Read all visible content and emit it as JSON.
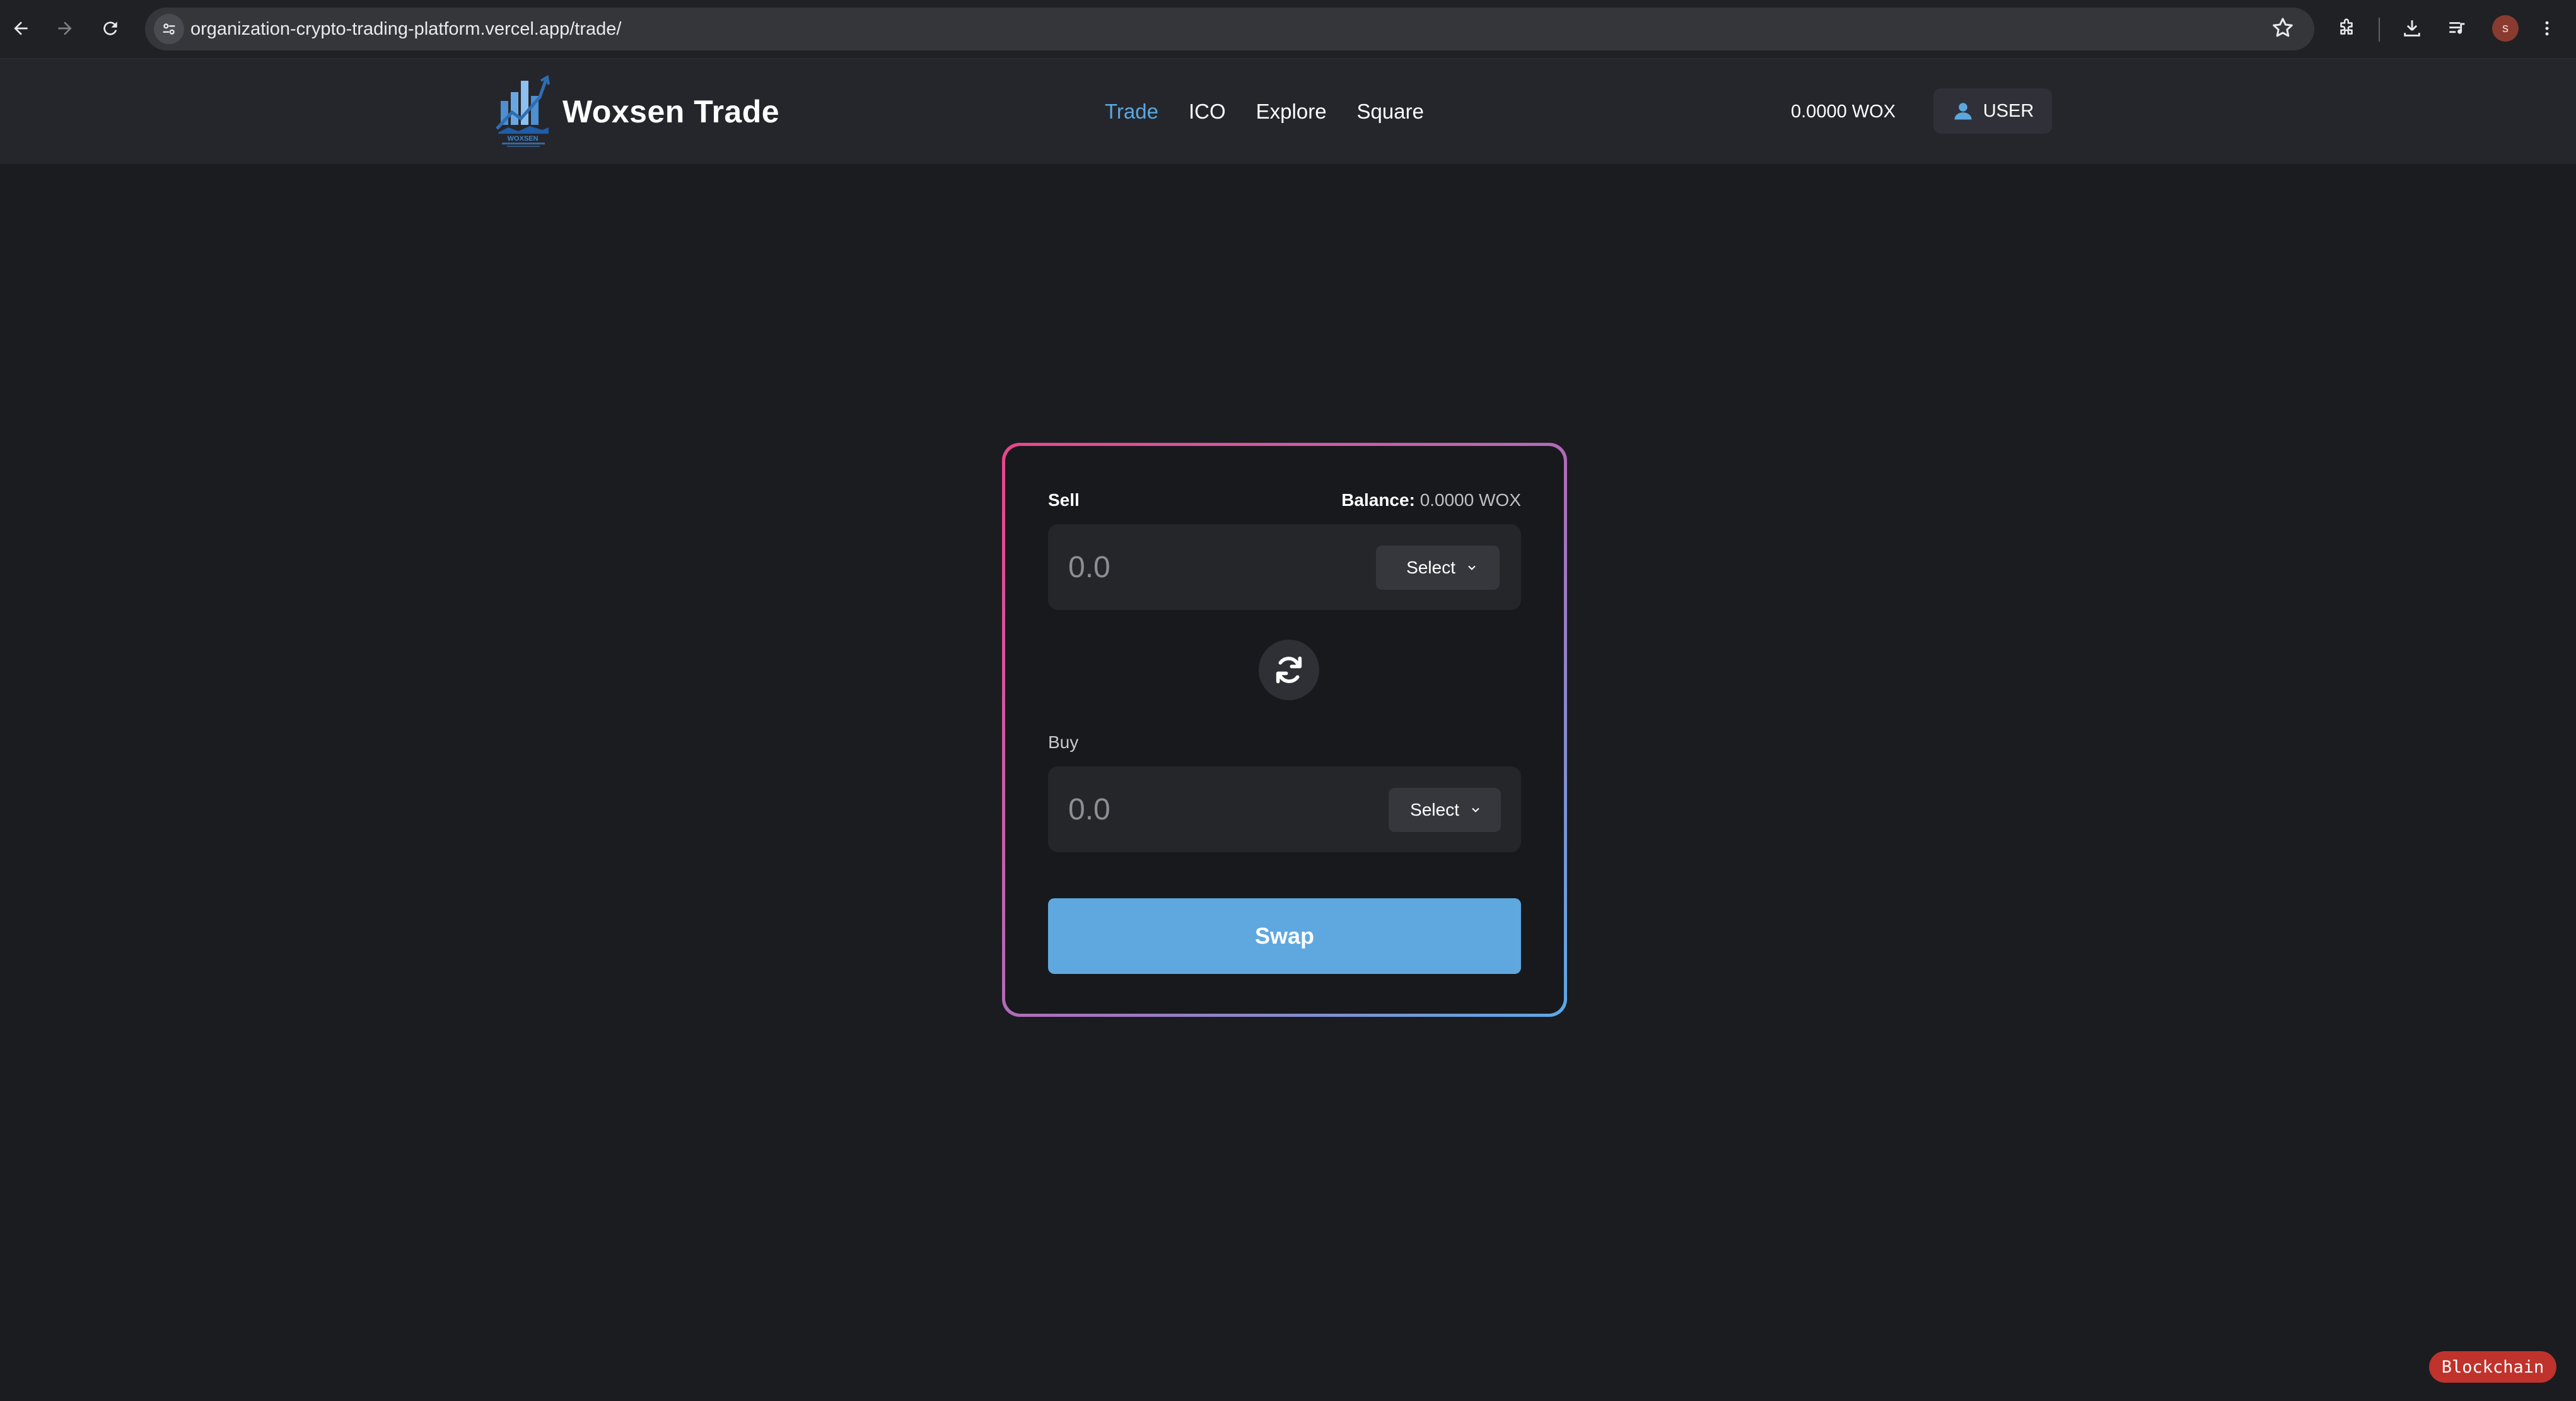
{
  "browser": {
    "url": "organization-crypto-trading-platform.vercel.app/trade/",
    "profile_initial": "s",
    "icons": [
      "back-icon",
      "forward-icon",
      "reload-icon",
      "site-info-icon",
      "bookmark-star-icon",
      "extensions-icon",
      "download-icon",
      "media-controls-icon",
      "menu-kebab-icon"
    ]
  },
  "header": {
    "brand_name": "Woxsen Trade",
    "nav": [
      {
        "label": "Trade",
        "active": true
      },
      {
        "label": "ICO",
        "active": false
      },
      {
        "label": "Explore",
        "active": false
      },
      {
        "label": "Square",
        "active": false
      }
    ],
    "wallet_balance": "0.0000 WOX",
    "user_label": "USER"
  },
  "swap": {
    "sell_label": "Sell",
    "balance_label": "Balance:",
    "balance_value": "0.0000 WOX",
    "sell_placeholder": "0.0",
    "sell_token_label": "Select",
    "buy_label": "Buy",
    "buy_placeholder": "0.0",
    "buy_token_label": "Select",
    "swap_button_label": "Swap"
  },
  "badge": {
    "label": "Blockchain"
  },
  "colors": {
    "accent": "#5ea8df",
    "active_nav": "#5ba8e0",
    "gradient_start": "#e9468a",
    "gradient_end": "#5aa9e6",
    "background": "#1b1c20",
    "badge": "#c0322c"
  }
}
